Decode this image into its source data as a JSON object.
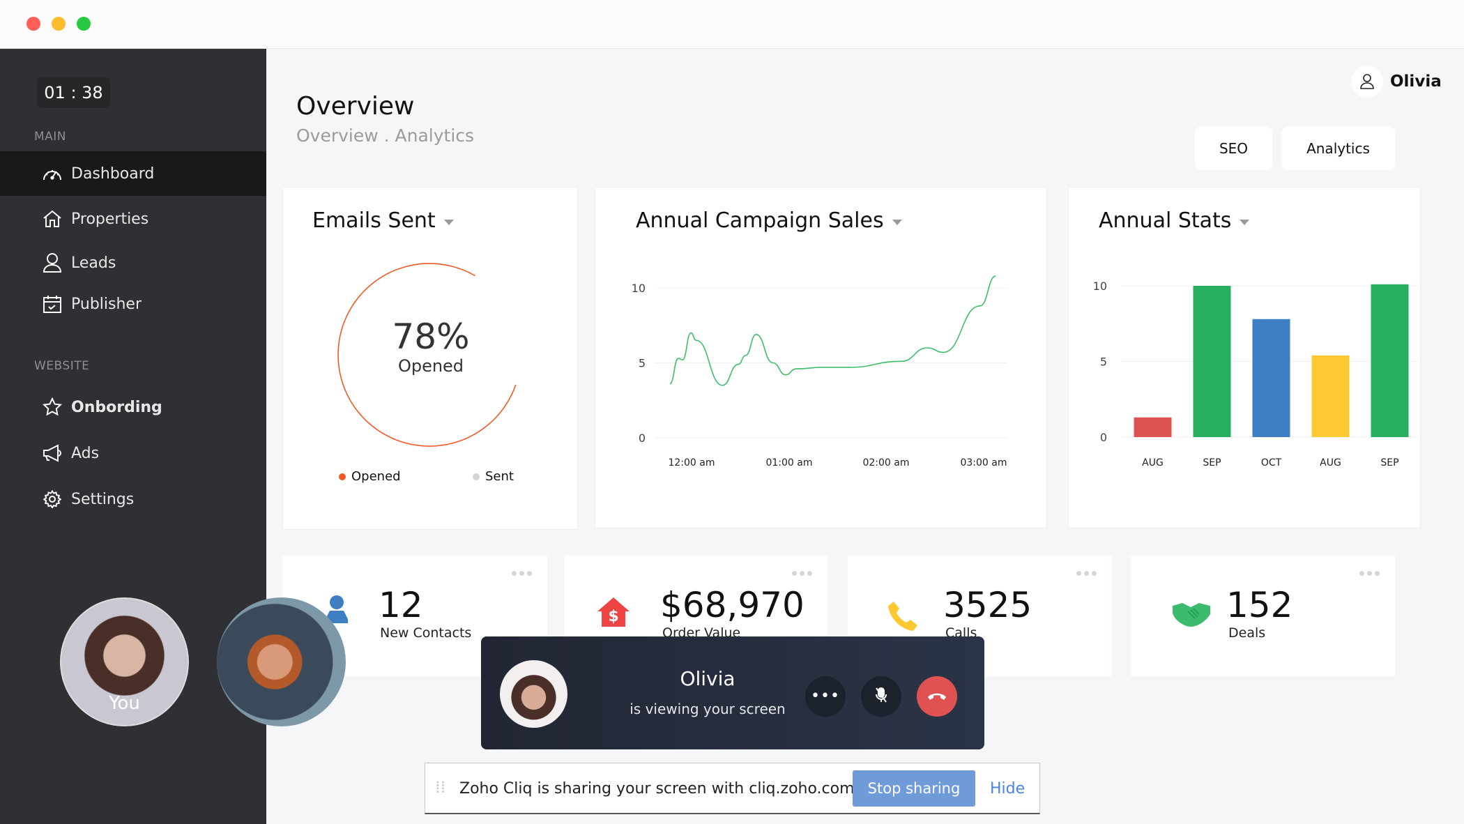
{
  "window": {
    "traffic_lights": {
      "close": "#fe5f57",
      "minimize": "#febc2e",
      "maximize": "#28c840"
    }
  },
  "sidebar": {
    "timer": "01 : 38",
    "sections": [
      {
        "label": "MAIN",
        "items": [
          {
            "label": "Dashboard",
            "icon": "dashboard-gauge-icon",
            "active": true
          },
          {
            "label": "Properties",
            "icon": "home-icon"
          },
          {
            "label": "Leads",
            "icon": "user-icon"
          },
          {
            "label": "Publisher",
            "icon": "calendar-check-icon"
          }
        ]
      },
      {
        "label": "WEBSITE",
        "items": [
          {
            "label": "Onbording",
            "icon": "star-icon",
            "bold": true
          },
          {
            "label": "Ads",
            "icon": "megaphone-icon"
          },
          {
            "label": "Settings",
            "icon": "gear-icon"
          }
        ]
      }
    ]
  },
  "header": {
    "title": "Overview",
    "breadcrumb": "Overview . Analytics",
    "user_name": "Olivia",
    "tabs": [
      "SEO",
      "Analytics"
    ]
  },
  "cards": {
    "emails": {
      "title": "Emails Sent",
      "percent_label": "78%",
      "sub_label": "Opened",
      "legend": [
        {
          "label": "Opened",
          "color": "#f15a24"
        },
        {
          "label": "Sent",
          "color": "#d4d4d4"
        }
      ]
    },
    "campaign": {
      "title": "Annual Campaign Sales"
    },
    "stats": {
      "title": "Annual Stats"
    }
  },
  "chart_data": [
    {
      "type": "pie",
      "title": "Emails Sent",
      "series": [
        {
          "name": "Opened",
          "value": 78,
          "color": "#f15a24"
        },
        {
          "name": "Sent",
          "value": 22,
          "color": "#d4d4d4"
        }
      ],
      "center_label": "78%",
      "center_sublabel": "Opened",
      "legend": "bottom"
    },
    {
      "type": "line",
      "title": "Annual Campaign Sales",
      "xlabel": "",
      "ylabel": "",
      "ylim": [
        0,
        10
      ],
      "yticks": [
        0,
        5,
        10
      ],
      "xticks": [
        "12:00 am",
        "01:00 am",
        "02:00 am",
        "03:00 am"
      ],
      "grid": true,
      "color": "#3dbd6b",
      "x": [
        0,
        0.08,
        0.12,
        0.2,
        0.25,
        0.5,
        0.65,
        0.72,
        0.82,
        0.98,
        1.1,
        1.2,
        1.45,
        1.7,
        2.2,
        2.45,
        2.6,
        2.95,
        3.1
      ],
      "y": [
        3.6,
        5.3,
        5.2,
        7.0,
        6.5,
        3.5,
        4.9,
        5.5,
        6.9,
        5.0,
        4.2,
        4.6,
        4.7,
        4.7,
        5.1,
        6.0,
        5.7,
        8.8,
        10.8
      ]
    },
    {
      "type": "bar",
      "title": "Annual Stats",
      "categories": [
        "AUG",
        "SEP",
        "OCT",
        "AUG",
        "SEP"
      ],
      "values": [
        1.3,
        10,
        7.8,
        5.4,
        10.1
      ],
      "colors": [
        "#dd5353",
        "#27ae60",
        "#3e7fc4",
        "#fec832",
        "#27ae60"
      ],
      "ylim": [
        0,
        10
      ],
      "yticks": [
        0,
        5,
        10
      ],
      "grid": true
    }
  ],
  "stat_tiles": [
    {
      "value": "12",
      "label": "New Contacts",
      "icon": "contact-person-icon",
      "color": "#3e7fc4"
    },
    {
      "value": "$68,970",
      "label": "Order Value",
      "icon": "house-dollar-icon",
      "color": "#ef4444"
    },
    {
      "value": "3525",
      "label": "Calls",
      "icon": "phone-icon",
      "color": "#fec832"
    },
    {
      "value": "152",
      "label": "Deals",
      "icon": "handshake-icon",
      "color": "#27ae60"
    }
  ],
  "participants": [
    {
      "label": "You"
    },
    {
      "label": ""
    }
  ],
  "call": {
    "name": "Olivia",
    "status": "is viewing your screen",
    "end_color": "#e05252"
  },
  "share_bar": {
    "message": "Zoho Cliq is sharing your screen with cliq.zoho.com.",
    "stop_label": "Stop sharing",
    "hide_label": "Hide"
  }
}
